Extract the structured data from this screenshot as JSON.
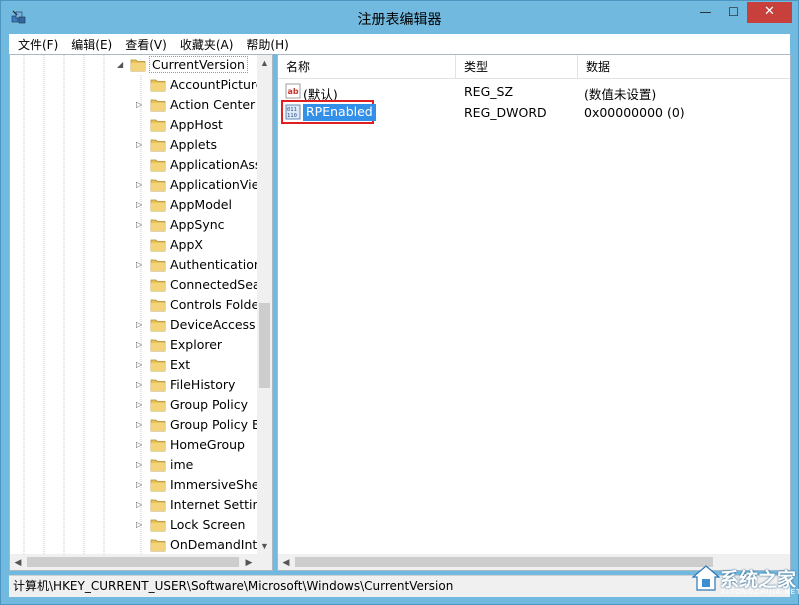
{
  "window": {
    "title": "注册表编辑器",
    "min_glyph": "—",
    "max_glyph": "☐",
    "close_glyph": "✕"
  },
  "menu": [
    "文件(F)",
    "编辑(E)",
    "查看(V)",
    "收藏夹(A)",
    "帮助(H)"
  ],
  "tree": {
    "selected": "CurrentVersion",
    "children": [
      {
        "label": "AccountPicture",
        "expandable": false
      },
      {
        "label": "Action Center",
        "expandable": true
      },
      {
        "label": "AppHost",
        "expandable": false
      },
      {
        "label": "Applets",
        "expandable": true
      },
      {
        "label": "ApplicationAss",
        "expandable": false
      },
      {
        "label": "ApplicationView",
        "expandable": true
      },
      {
        "label": "AppModel",
        "expandable": true
      },
      {
        "label": "AppSync",
        "expandable": true
      },
      {
        "label": "AppX",
        "expandable": false
      },
      {
        "label": "Authentication",
        "expandable": true
      },
      {
        "label": "ConnectedSear",
        "expandable": false
      },
      {
        "label": "Controls Folde",
        "expandable": false
      },
      {
        "label": "DeviceAccess",
        "expandable": true
      },
      {
        "label": "Explorer",
        "expandable": true
      },
      {
        "label": "Ext",
        "expandable": true
      },
      {
        "label": "FileHistory",
        "expandable": true
      },
      {
        "label": "Group Policy",
        "expandable": true
      },
      {
        "label": "Group Policy E",
        "expandable": true
      },
      {
        "label": "HomeGroup",
        "expandable": true
      },
      {
        "label": "ime",
        "expandable": true
      },
      {
        "label": "ImmersiveShel",
        "expandable": true
      },
      {
        "label": "Internet Setting",
        "expandable": true
      },
      {
        "label": "Lock Screen",
        "expandable": true
      },
      {
        "label": "OnDemandInte",
        "expandable": false
      }
    ]
  },
  "values": {
    "headers": {
      "name": "名称",
      "type": "类型",
      "data": "数据"
    },
    "rows": [
      {
        "name": "(默认)",
        "type": "REG_SZ",
        "data": "(数值未设置)",
        "icon": "string-value-icon",
        "selected": false
      },
      {
        "name": "RPEnabled",
        "type": "REG_DWORD",
        "data": "0x00000000 (0)",
        "icon": "dword-value-icon",
        "selected": true
      }
    ]
  },
  "status": {
    "path": "计算机\\HKEY_CURRENT_USER\\Software\\Microsoft\\Windows\\CurrentVersion"
  },
  "watermark": {
    "text": "系统之家",
    "sub": "XITONGZHIJIA.NET"
  },
  "colors": {
    "window_frame": "#71b9df",
    "close_button": "#c7403b",
    "selection": "#3390e8",
    "highlight_box": "#e02020",
    "folder": "#e8c15a"
  }
}
